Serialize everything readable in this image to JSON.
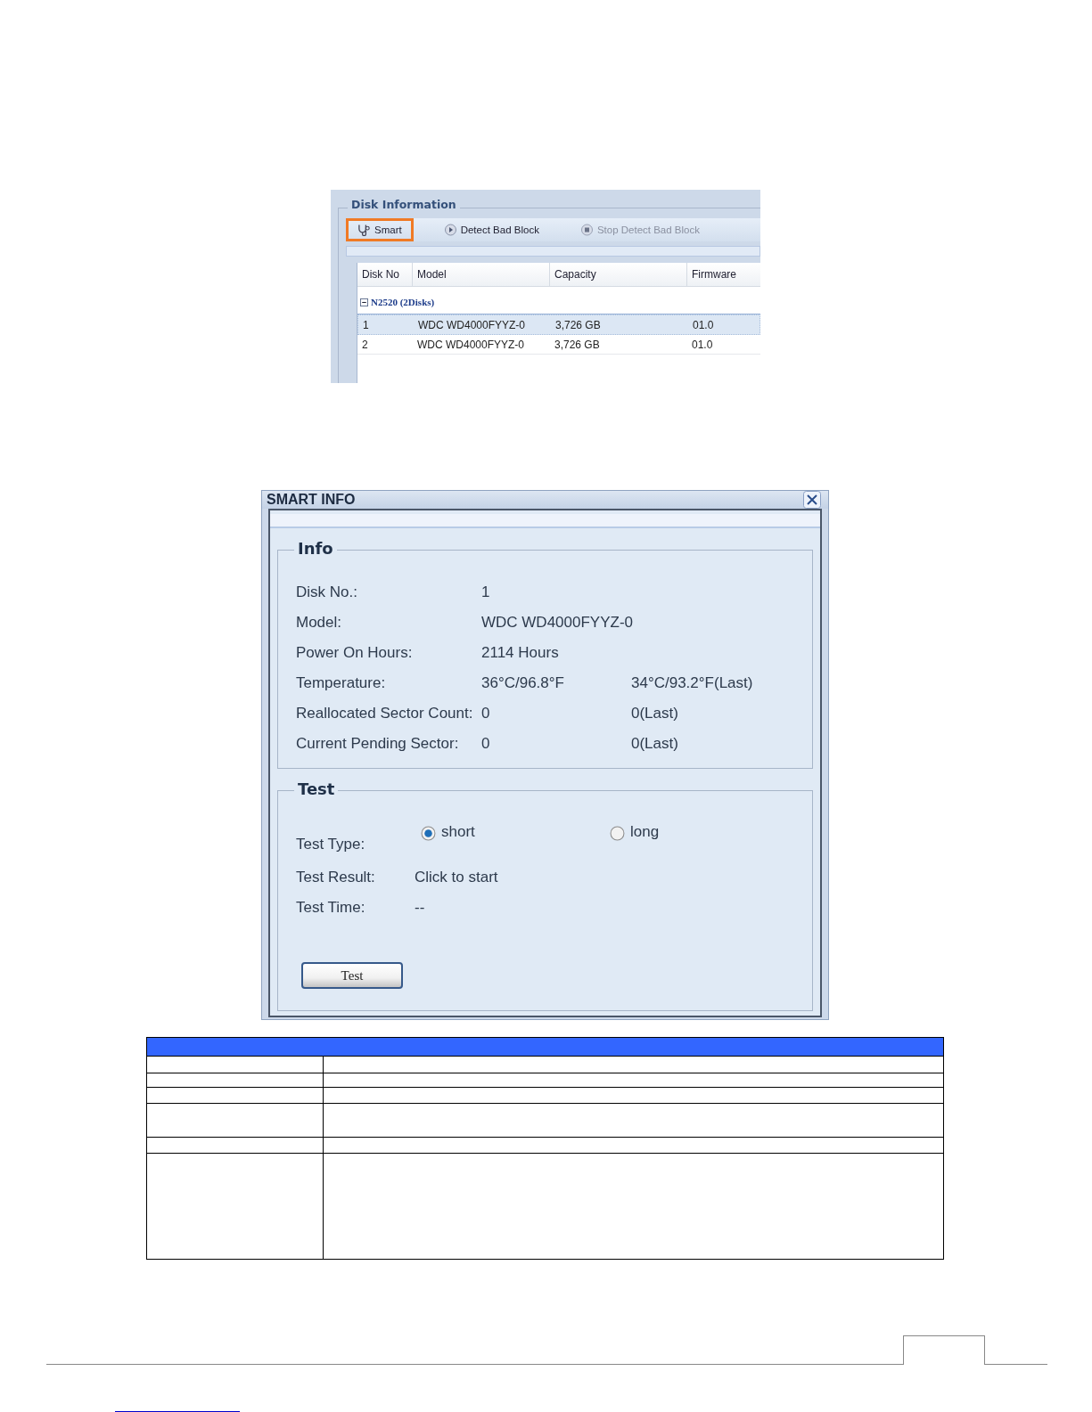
{
  "disk_panel": {
    "title": "Disk Information",
    "toolbar": [
      {
        "label": "Smart",
        "kind": "smart",
        "highlighted": true,
        "disabled": false
      },
      {
        "label": "Detect Bad Block",
        "kind": "play",
        "highlighted": false,
        "disabled": false
      },
      {
        "label": "Stop Detect Bad Block",
        "kind": "stop",
        "highlighted": false,
        "disabled": true
      }
    ],
    "columns": [
      "Disk No",
      "Model",
      "Capacity",
      "Firmware"
    ],
    "group": {
      "label": "N2520 (2Disks)",
      "expanded": true
    },
    "rows": [
      {
        "cells": [
          "1",
          "WDC WD4000FYYZ-0",
          "3,726 GB",
          "01.0"
        ],
        "selected": true
      },
      {
        "cells": [
          "2",
          "WDC WD4000FYYZ-0",
          "3,726 GB",
          "01.0"
        ],
        "selected": false
      }
    ]
  },
  "dialog": {
    "title": "SMART INFO",
    "info": {
      "legend": "Info",
      "fields": [
        {
          "label": "Disk No.:",
          "value": "1"
        },
        {
          "label": "Model:",
          "value": "WDC WD4000FYYZ-0"
        },
        {
          "label": "Power On Hours:",
          "value": "2114 Hours"
        },
        {
          "label": "Temperature:",
          "value": "36°C/96.8°F",
          "last": "34°C/93.2°F(Last)"
        },
        {
          "label": "Reallocated Sector Count:",
          "value": "0",
          "last": "0(Last)"
        },
        {
          "label": "Current Pending Sector:",
          "value": "0",
          "last": "0(Last)"
        }
      ]
    },
    "test": {
      "legend": "Test",
      "type_label": "Test Type:",
      "options": [
        {
          "label": "short",
          "selected": true
        },
        {
          "label": "long",
          "selected": false
        }
      ],
      "fields": [
        {
          "label": "Test Result:",
          "value": "Click to start"
        },
        {
          "label": "Test Time:",
          "value": "--"
        }
      ],
      "button": "Test"
    }
  }
}
